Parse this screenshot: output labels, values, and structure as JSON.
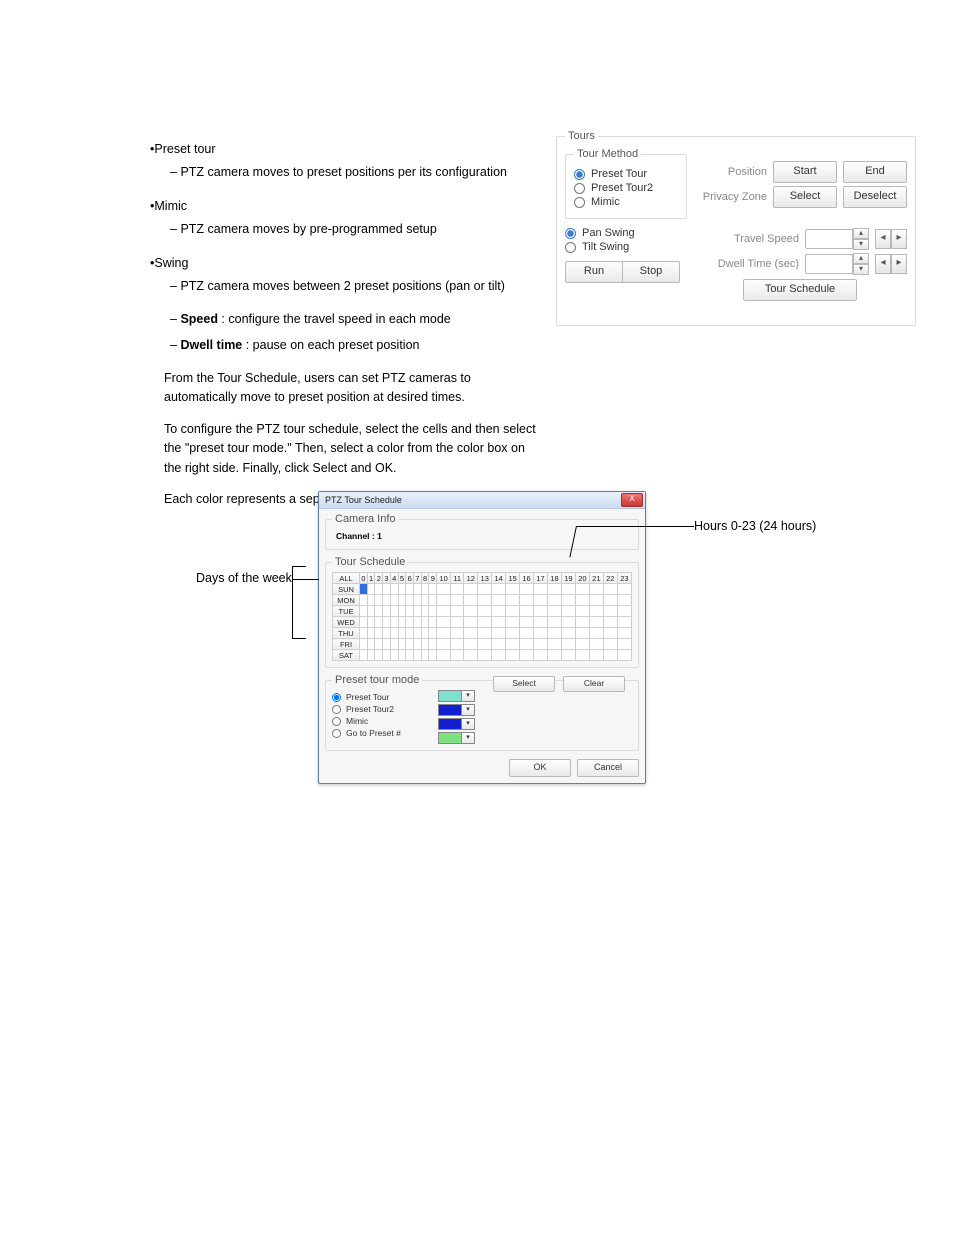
{
  "doc": {
    "l1": "Preset tour",
    "l1s": "PTZ camera moves to preset positions per its configuration",
    "l2": "Mimic",
    "l2s": "PTZ camera moves by pre-programmed setup",
    "l3": "Swing",
    "l3s": "PTZ camera moves between 2 preset positions (pan or tilt)",
    "l4": "Speed",
    "l4x": " : configure the travel speed in each mode",
    "l5": "Dwell time",
    "l5x": " : pause on each preset position",
    "body1": "From the Tour Schedule, users can set PTZ cameras to automatically move to preset position at desired times.",
    "body2": "To configure the PTZ tour schedule, select the cells and then select the \"preset tour mode.\" Then, select a color from the color box on the right side. Finally, click Select and OK.",
    "body3": "Each color represents a separate preset or series of presets."
  },
  "tours": {
    "legend": "Tours",
    "method_legend": "Tour Method",
    "preset_tour": "Preset Tour",
    "preset_tour2": "Preset Tour2",
    "mimic": "Mimic",
    "pan_swing": "Pan Swing",
    "tilt_swing": "Tilt Swing",
    "position": "Position",
    "start": "Start",
    "end": "End",
    "privacy": "Privacy Zone",
    "select": "Select",
    "deselect": "Deselect",
    "travel": "Travel Speed",
    "dwell": "Dwell Time (sec)",
    "run": "Run",
    "stop": "Stop",
    "tour_schedule": "Tour Schedule"
  },
  "dlg": {
    "title": "PTZ Tour Schedule",
    "close": "X",
    "camera_info": "Camera Info",
    "channel": "Channel : 1",
    "tour_schedule": "Tour Schedule",
    "all": "ALL",
    "days": [
      "SUN",
      "MON",
      "TUE",
      "WED",
      "THU",
      "FRI",
      "SAT"
    ],
    "hours": [
      "0",
      "1",
      "2",
      "3",
      "4",
      "5",
      "6",
      "7",
      "8",
      "9",
      "10",
      "11",
      "12",
      "13",
      "14",
      "15",
      "16",
      "17",
      "18",
      "19",
      "20",
      "21",
      "22",
      "23"
    ],
    "ptm_legend": "Preset tour mode",
    "m1": "Preset Tour",
    "m2": "Preset Tour2",
    "m3": "Mimic",
    "m4": "Go to Preset #",
    "colors": {
      "m1": "#7fe0d0",
      "m2": "#1020d0",
      "m3": "#1020d0",
      "m4": "#7fe07f"
    },
    "select": "Select",
    "clear": "Clear",
    "ok": "OK",
    "cancel": "Cancel"
  },
  "ann": {
    "days": "Days of the week",
    "hours": "Hours 0-23 (24 hours)"
  }
}
